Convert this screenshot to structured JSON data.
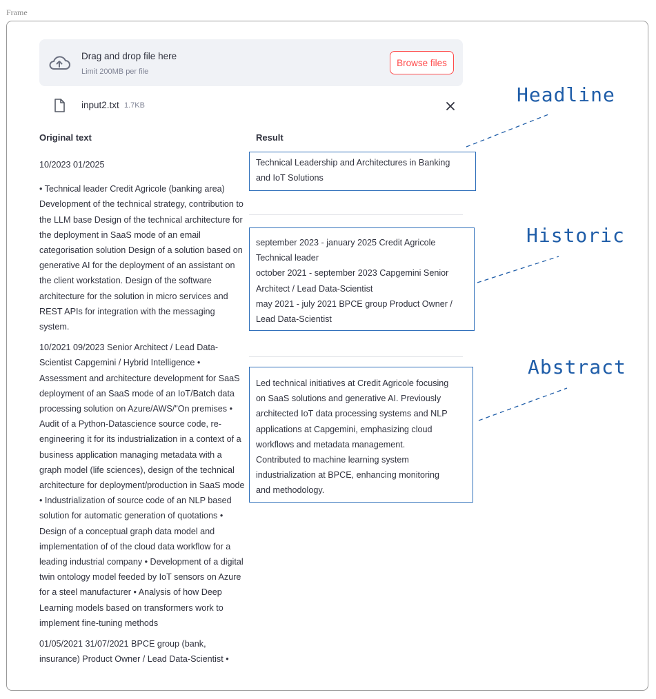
{
  "frame_label": "Frame",
  "uploader": {
    "title": "Drag and drop file here",
    "limit": "Limit 200MB per file",
    "browse_label": "Browse files",
    "icon": "cloud-upload-icon"
  },
  "file": {
    "name": "input2.txt",
    "size": "1.7KB",
    "icon": "file-icon",
    "remove_icon": "close-icon"
  },
  "original": {
    "header": "Original text",
    "paragraphs": [
      "10/2023 01/2025",
      "• Technical leader Credit Agricole (banking area) Development of the technical strategy, contribution to the LLM base Design of the technical architecture for the deployment in SaaS mode of an email categorisation solution Design of a solution based on generative AI for the deployment of an assistant on the client workstation. Design of the software architecture for the solution in micro services and REST APIs for integration with the messaging system.",
      "10/2021 09/2023 Senior Architect / Lead Data-Scientist Capgemini / Hybrid Intelligence • Assessment and architecture development for SaaS deployment of an SaaS mode of an IoT/Batch data processing solution on Azure/AWS/\"On premises • Audit of a Python-Datascience source code, re-engineering it for its industrialization in a context of a business application managing metadata with a graph model (life sciences), design of the technical architecture for deployment/production in SaaS mode • Industrialization of source code of an NLP based solution for automatic generation of quotations • Design of a conceptual graph data model and implementation of of the cloud data workflow for a leading industrial company • Development of a digital twin ontology model feeded by IoT sensors on Azure for a steel manufacturer • Analysis of how Deep Learning models based on transformers work to implement fine-tuning methods",
      "01/05/2021 31/07/2021 BPCE group (bank, insurance) Product Owner / Lead Data-Scientist •"
    ]
  },
  "result": {
    "header": "Result",
    "headline": [
      "Technical Leadership and Architectures in Banking",
      "and IoT Solutions"
    ],
    "historic": [
      "september 2023 - january 2025 Credit Agricole",
      "Technical leader",
      "october 2021 - september 2023 Capgemini Senior",
      "Architect / Lead Data-Scientist",
      "may 2021 - july 2021 BPCE group Product Owner /",
      "Lead Data-Scientist"
    ],
    "abstract": [
      "Led technical initiatives at Credit Agricole focusing",
      "on SaaS solutions and generative AI. Previously",
      "architected IoT data processing systems and NLP",
      "applications at Capgemini, emphasizing cloud",
      "workflows and metadata management.",
      "Contributed to machine learning system",
      "industrialization at BPCE, enhancing monitoring",
      "and methodology."
    ]
  },
  "annotations": {
    "headline": "Headline",
    "historic": "Historic",
    "abstract": "Abstract",
    "color": "#1f5da8"
  }
}
